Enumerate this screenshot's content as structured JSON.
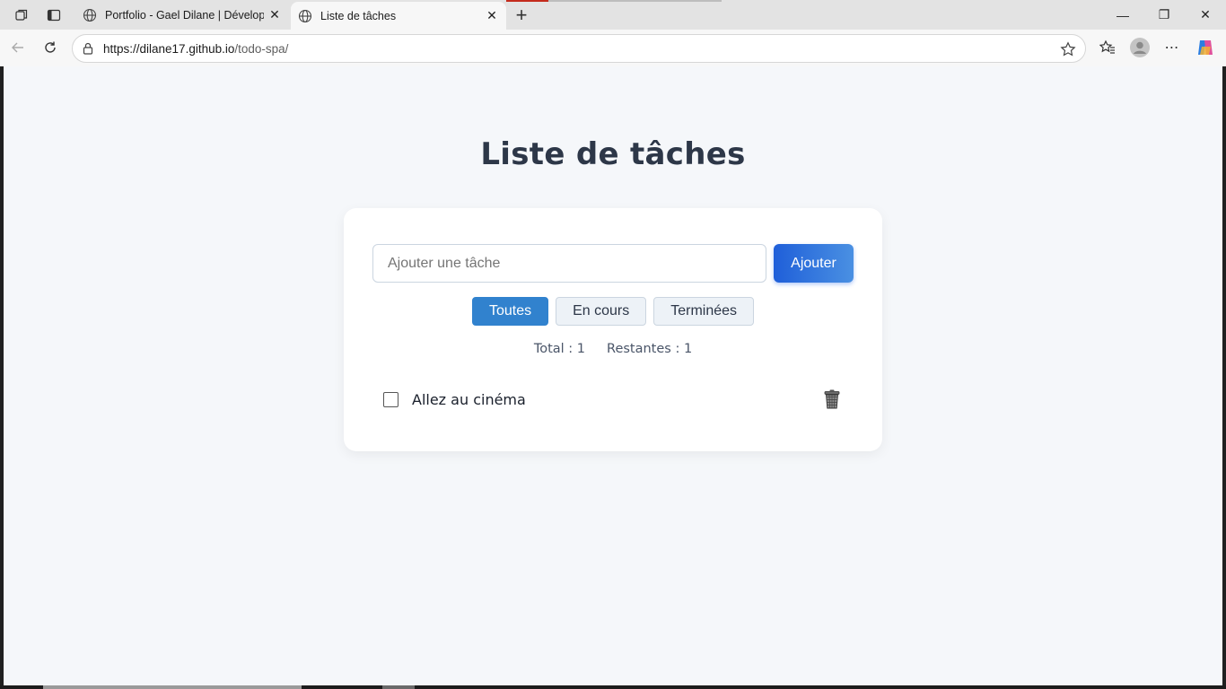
{
  "browser": {
    "tabs": [
      {
        "title": "Portfolio - Gael Dilane | Développ"
      },
      {
        "title": "Liste de tâches"
      }
    ],
    "url_host": "https://dilane17.github.io",
    "url_path": "/todo-spa/"
  },
  "app": {
    "title": "Liste de tâches",
    "input_placeholder": "Ajouter une tâche",
    "add_label": "Ajouter",
    "filters": [
      {
        "label": "Toutes",
        "active": true
      },
      {
        "label": "En cours",
        "active": false
      },
      {
        "label": "Terminées",
        "active": false
      }
    ],
    "total_text": "Total : 1",
    "remaining_text": "Restantes : 1",
    "tasks": [
      {
        "text": "Allez au cinéma",
        "done": false
      }
    ]
  },
  "colors": {
    "accent": "#3182ce",
    "add_button_gradient": [
      "#1f5fd9",
      "#4a90e2"
    ],
    "title": "#2d3748",
    "page_bg": "#f5f7fa"
  }
}
